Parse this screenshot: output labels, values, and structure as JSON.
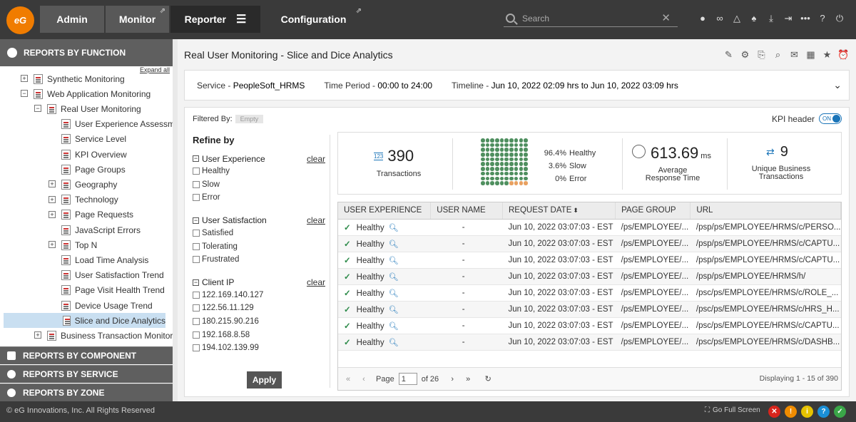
{
  "topnav": {
    "logo": "eG",
    "tabs": [
      {
        "label": "Admin"
      },
      {
        "label": "Monitor"
      },
      {
        "label": "Reporter"
      },
      {
        "label": "Configuration"
      }
    ],
    "search_placeholder": "Search"
  },
  "sidebar": {
    "header": "REPORTS BY FUNCTION",
    "expand_all": "Expand all",
    "tree": [
      {
        "label": "Synthetic Monitoring",
        "pm": "+"
      },
      {
        "label": "Web Application Monitoring",
        "pm": "−"
      },
      {
        "label": "Real User Monitoring",
        "pm": "−"
      },
      {
        "label": "User Experience Assessm"
      },
      {
        "label": "Service Level"
      },
      {
        "label": "KPI Overview"
      },
      {
        "label": "Page Groups"
      },
      {
        "label": "Geography",
        "pm": "+"
      },
      {
        "label": "Technology",
        "pm": "+"
      },
      {
        "label": "Page Requests",
        "pm": "+"
      },
      {
        "label": "JavaScript Errors"
      },
      {
        "label": "Top N",
        "pm": "+"
      },
      {
        "label": "Load Time Analysis"
      },
      {
        "label": "User Satisfaction Trend"
      },
      {
        "label": "Page Visit Health Trend"
      },
      {
        "label": "Device Usage Trend"
      },
      {
        "label": "Slice and Dice Analytics"
      },
      {
        "label": "Business Transaction Monitor",
        "pm": "+"
      }
    ],
    "sections": [
      {
        "label": "REPORTS BY COMPONENT"
      },
      {
        "label": "REPORTS BY SERVICE"
      },
      {
        "label": "REPORTS BY ZONE"
      }
    ]
  },
  "page": {
    "title": "Real User Monitoring - Slice and Dice Analytics",
    "service_label": "Service - ",
    "service_value": "PeopleSoft_HRMS",
    "period_label": "Time Period - ",
    "period_value": "00:00 to 24:00",
    "timeline_label": "Timeline - ",
    "timeline_value": "Jun 10, 2022 02:09 hrs to Jun 10, 2022 03:09 hrs",
    "filtered_by": "Filtered By:",
    "filtered_value": "Empty",
    "kpi_header": "KPI header",
    "kpi_toggle": "ON"
  },
  "refine": {
    "title": "Refine by",
    "clear": "clear",
    "groups": [
      {
        "title": "User Experience",
        "options": [
          "Healthy",
          "Slow",
          "Error"
        ]
      },
      {
        "title": "User Satisfaction",
        "options": [
          "Satisfied",
          "Tolerating",
          "Frustrated"
        ]
      },
      {
        "title": "Client IP",
        "options": [
          "122.169.140.127",
          "122.56.11.129",
          "180.215.90.216",
          "192.168.8.58",
          "194.102.139.99"
        ]
      }
    ],
    "apply": "Apply"
  },
  "kpis": {
    "transactions_value": "390",
    "transactions_label": "Transactions",
    "transactions_icon": "123",
    "healthy_pct": "96.4%",
    "healthy_label": "Healthy",
    "slow_pct": "3.6%",
    "slow_label": "Slow",
    "error_pct": "0%",
    "error_label": "Error",
    "avg_rt_value": "613.69",
    "avg_rt_unit": "ms",
    "avg_rt_label1": "Average",
    "avg_rt_label2": "Response Time",
    "unique_value": "9",
    "unique_label1": "Unique Business",
    "unique_label2": "Transactions",
    "dots_healthy_fraction": 0.964,
    "dot_colors": {
      "healthy": "#4f8f5f",
      "slow": "#e8a060"
    }
  },
  "table": {
    "columns": [
      "USER EXPERIENCE",
      "USER NAME",
      "REQUEST DATE",
      "PAGE GROUP",
      "URL"
    ],
    "rows": [
      {
        "exp": "Healthy",
        "user": "-",
        "date": "Jun 10, 2022 03:07:03 - EST",
        "group": "/ps/EMPLOYEE/...",
        "url": "/psp/ps/EMPLOYEE/HRMS/c/PERSO..."
      },
      {
        "exp": "Healthy",
        "user": "-",
        "date": "Jun 10, 2022 03:07:03 - EST",
        "group": "/ps/EMPLOYEE/...",
        "url": "/psp/ps/EMPLOYEE/HRMS/c/CAPTU..."
      },
      {
        "exp": "Healthy",
        "user": "-",
        "date": "Jun 10, 2022 03:07:03 - EST",
        "group": "/ps/EMPLOYEE/...",
        "url": "/psp/ps/EMPLOYEE/HRMS/c/CAPTU..."
      },
      {
        "exp": "Healthy",
        "user": "-",
        "date": "Jun 10, 2022 03:07:03 - EST",
        "group": "/ps/EMPLOYEE/...",
        "url": "/psp/ps/EMPLOYEE/HRMS/h/"
      },
      {
        "exp": "Healthy",
        "user": "-",
        "date": "Jun 10, 2022 03:07:03 - EST",
        "group": "/ps/EMPLOYEE/...",
        "url": "/psc/ps/EMPLOYEE/HRMS/c/ROLE_..."
      },
      {
        "exp": "Healthy",
        "user": "-",
        "date": "Jun 10, 2022 03:07:03 - EST",
        "group": "/ps/EMPLOYEE/...",
        "url": "/psc/ps/EMPLOYEE/HRMS/c/HRS_H..."
      },
      {
        "exp": "Healthy",
        "user": "-",
        "date": "Jun 10, 2022 03:07:03 - EST",
        "group": "/ps/EMPLOYEE/...",
        "url": "/psc/ps/EMPLOYEE/HRMS/c/CAPTU..."
      },
      {
        "exp": "Healthy",
        "user": "-",
        "date": "Jun 10, 2022 03:07:03 - EST",
        "group": "/ps/EMPLOYEE/...",
        "url": "/psc/ps/EMPLOYEE/HRMS/c/DASHB..."
      }
    ],
    "pager": {
      "page_label": "Page",
      "page_value": "1",
      "of_label": "of 26",
      "displaying": "Displaying 1 - 15 of 390"
    }
  },
  "footer": {
    "copyright": "© eG Innovations, Inc. All Rights Reserved",
    "full_screen": "Go Full Screen"
  }
}
